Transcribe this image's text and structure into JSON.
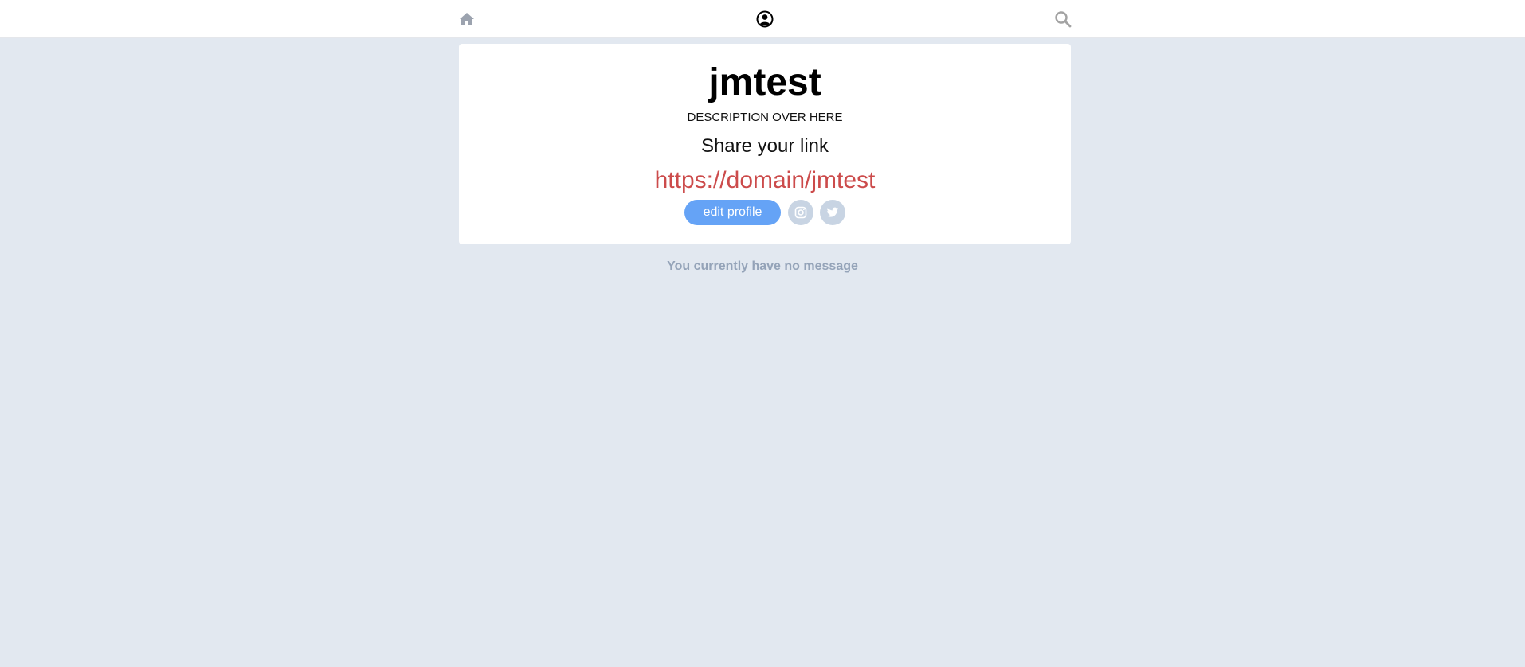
{
  "nav": {
    "home_icon": "home-icon",
    "profile_icon": "user-circle-icon",
    "search_icon": "search-icon"
  },
  "profile": {
    "username": "jmtest",
    "description": "DESCRIPTION OVER HERE",
    "share_label": "Share your link",
    "share_url": "https://domain/jmtest",
    "edit_button_label": "edit profile",
    "social": [
      {
        "icon": "instagram-icon"
      },
      {
        "icon": "twitter-icon"
      }
    ]
  },
  "messages": {
    "empty_text": "You currently have no message"
  },
  "colors": {
    "background": "#e2e8f0",
    "link": "#cc4b4b",
    "button": "#65a3f6",
    "muted_text": "#94a3b8"
  }
}
